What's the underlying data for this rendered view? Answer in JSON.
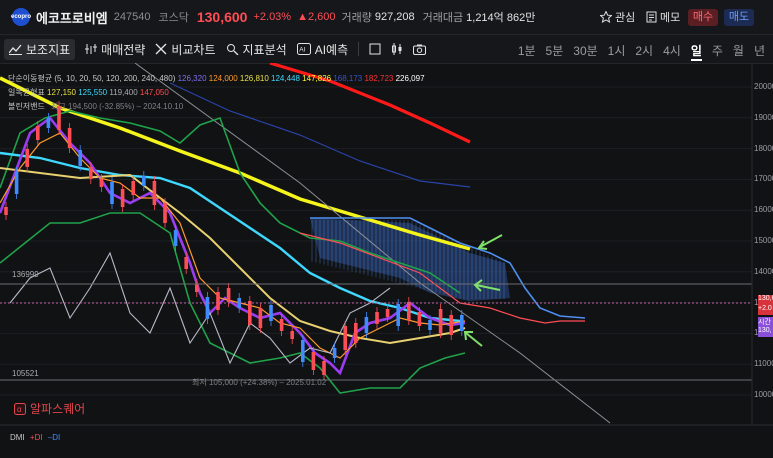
{
  "header": {
    "logo_text": "ecopro",
    "stock_name": "에코프로비엠",
    "code": "247540",
    "market": "코스닥",
    "price": "130,600",
    "change_pct": "+2.03%",
    "change_amt": "▲2,600",
    "volume_label": "거래량",
    "volume": "927,208",
    "amount_label": "거래대금",
    "amount": "1,214억 862만",
    "watch_label": "관심",
    "memo_label": "메모",
    "buy_label": "매수",
    "sell_label": "매도"
  },
  "toolbar": {
    "tools": [
      "보조지표",
      "매매전략",
      "비교차트",
      "지표분석",
      "AI예측"
    ],
    "periods": [
      "1분",
      "5분",
      "30분",
      "1시",
      "2시",
      "4시",
      "일",
      "주",
      "월",
      "년"
    ],
    "selected_period": "일"
  },
  "legend": {
    "ma_label": "단순이동평균 (5, 10, 20, 50, 120, 200, 240, 480)",
    "ma_values": [
      {
        "v": "126,320",
        "color": "#7f6ff0"
      },
      {
        "v": "124,000",
        "color": "#ff9a2e"
      },
      {
        "v": "126,810",
        "color": "#e8e04a"
      },
      {
        "v": "124,448",
        "color": "#3fd8ff"
      },
      {
        "v": "147,826",
        "color": "#ffff33"
      },
      {
        "v": "168,173",
        "color": "#3854c8"
      },
      {
        "v": "182,723",
        "color": "#ff3030"
      },
      {
        "v": "226,097",
        "color": "#ffffff"
      }
    ],
    "ichimoku_label": "일목균형표",
    "ichimoku_values": [
      {
        "v": "127,150",
        "color": "#e8e04a"
      },
      {
        "v": "125,550",
        "color": "#3fd8ff"
      },
      {
        "v": "119,400",
        "color": "#a8abb0"
      },
      {
        "v": "147,050",
        "color": "#ff4d55"
      }
    ],
    "bollinger_label": "볼린저밴드",
    "bollinger_extra": "최고 194,500 (-32.85%) – 2024.10.10"
  },
  "chart_data": {
    "type": "line",
    "title": "",
    "y_axis_labels": [
      "200000",
      "190000",
      "180000",
      "170000",
      "160000",
      "150000",
      "140000",
      "130000",
      "120000",
      "110000",
      "100000"
    ],
    "horizontal_lines": [
      "136999",
      "105521"
    ],
    "low_annotation": "최저 105,000 (+24.38%) – 2025.01.02",
    "current_price_tag": "130,6",
    "current_change_tag": "+2.0",
    "time_tag": "시간",
    "secondary_tag": "130,"
  },
  "watermark": "알파스퀘어",
  "dmi": {
    "label": "DMI",
    "plus": "+DI",
    "minus": "–DI"
  },
  "colors": {
    "up": "#ff4d55",
    "background": "#111214"
  }
}
